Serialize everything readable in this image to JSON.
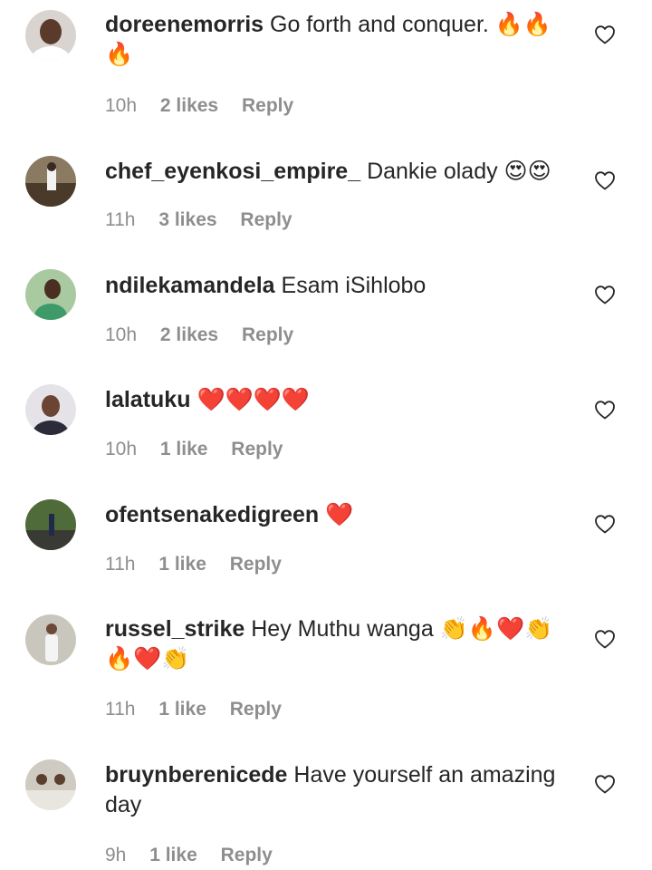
{
  "comments": [
    {
      "username": "doreenemorris",
      "text": "Go forth and conquer. 🔥🔥🔥",
      "time": "10h",
      "likes": "2 likes",
      "reply": "Reply"
    },
    {
      "username": "chef_eyenkosi_empire_",
      "text": "Dankie olady 😍😍",
      "time": "11h",
      "likes": "3 likes",
      "reply": "Reply"
    },
    {
      "username": "ndilekamandela",
      "text": "Esam iSihlobo",
      "time": "10h",
      "likes": "2 likes",
      "reply": "Reply"
    },
    {
      "username": "lalatuku",
      "text": "❤️❤️❤️❤️",
      "time": "10h",
      "likes": "1 like",
      "reply": "Reply"
    },
    {
      "username": "ofentsenakedigreen",
      "text": "❤️",
      "time": "11h",
      "likes": "1 like",
      "reply": "Reply"
    },
    {
      "username": "russel_strike",
      "text": "Hey Muthu wanga 👏🔥❤️👏🔥❤️👏",
      "time": "11h",
      "likes": "1 like",
      "reply": "Reply"
    },
    {
      "username": "bruynberenicede",
      "text": "Have yourself an amazing day",
      "time": "9h",
      "likes": "1 like",
      "reply": "Reply"
    }
  ]
}
